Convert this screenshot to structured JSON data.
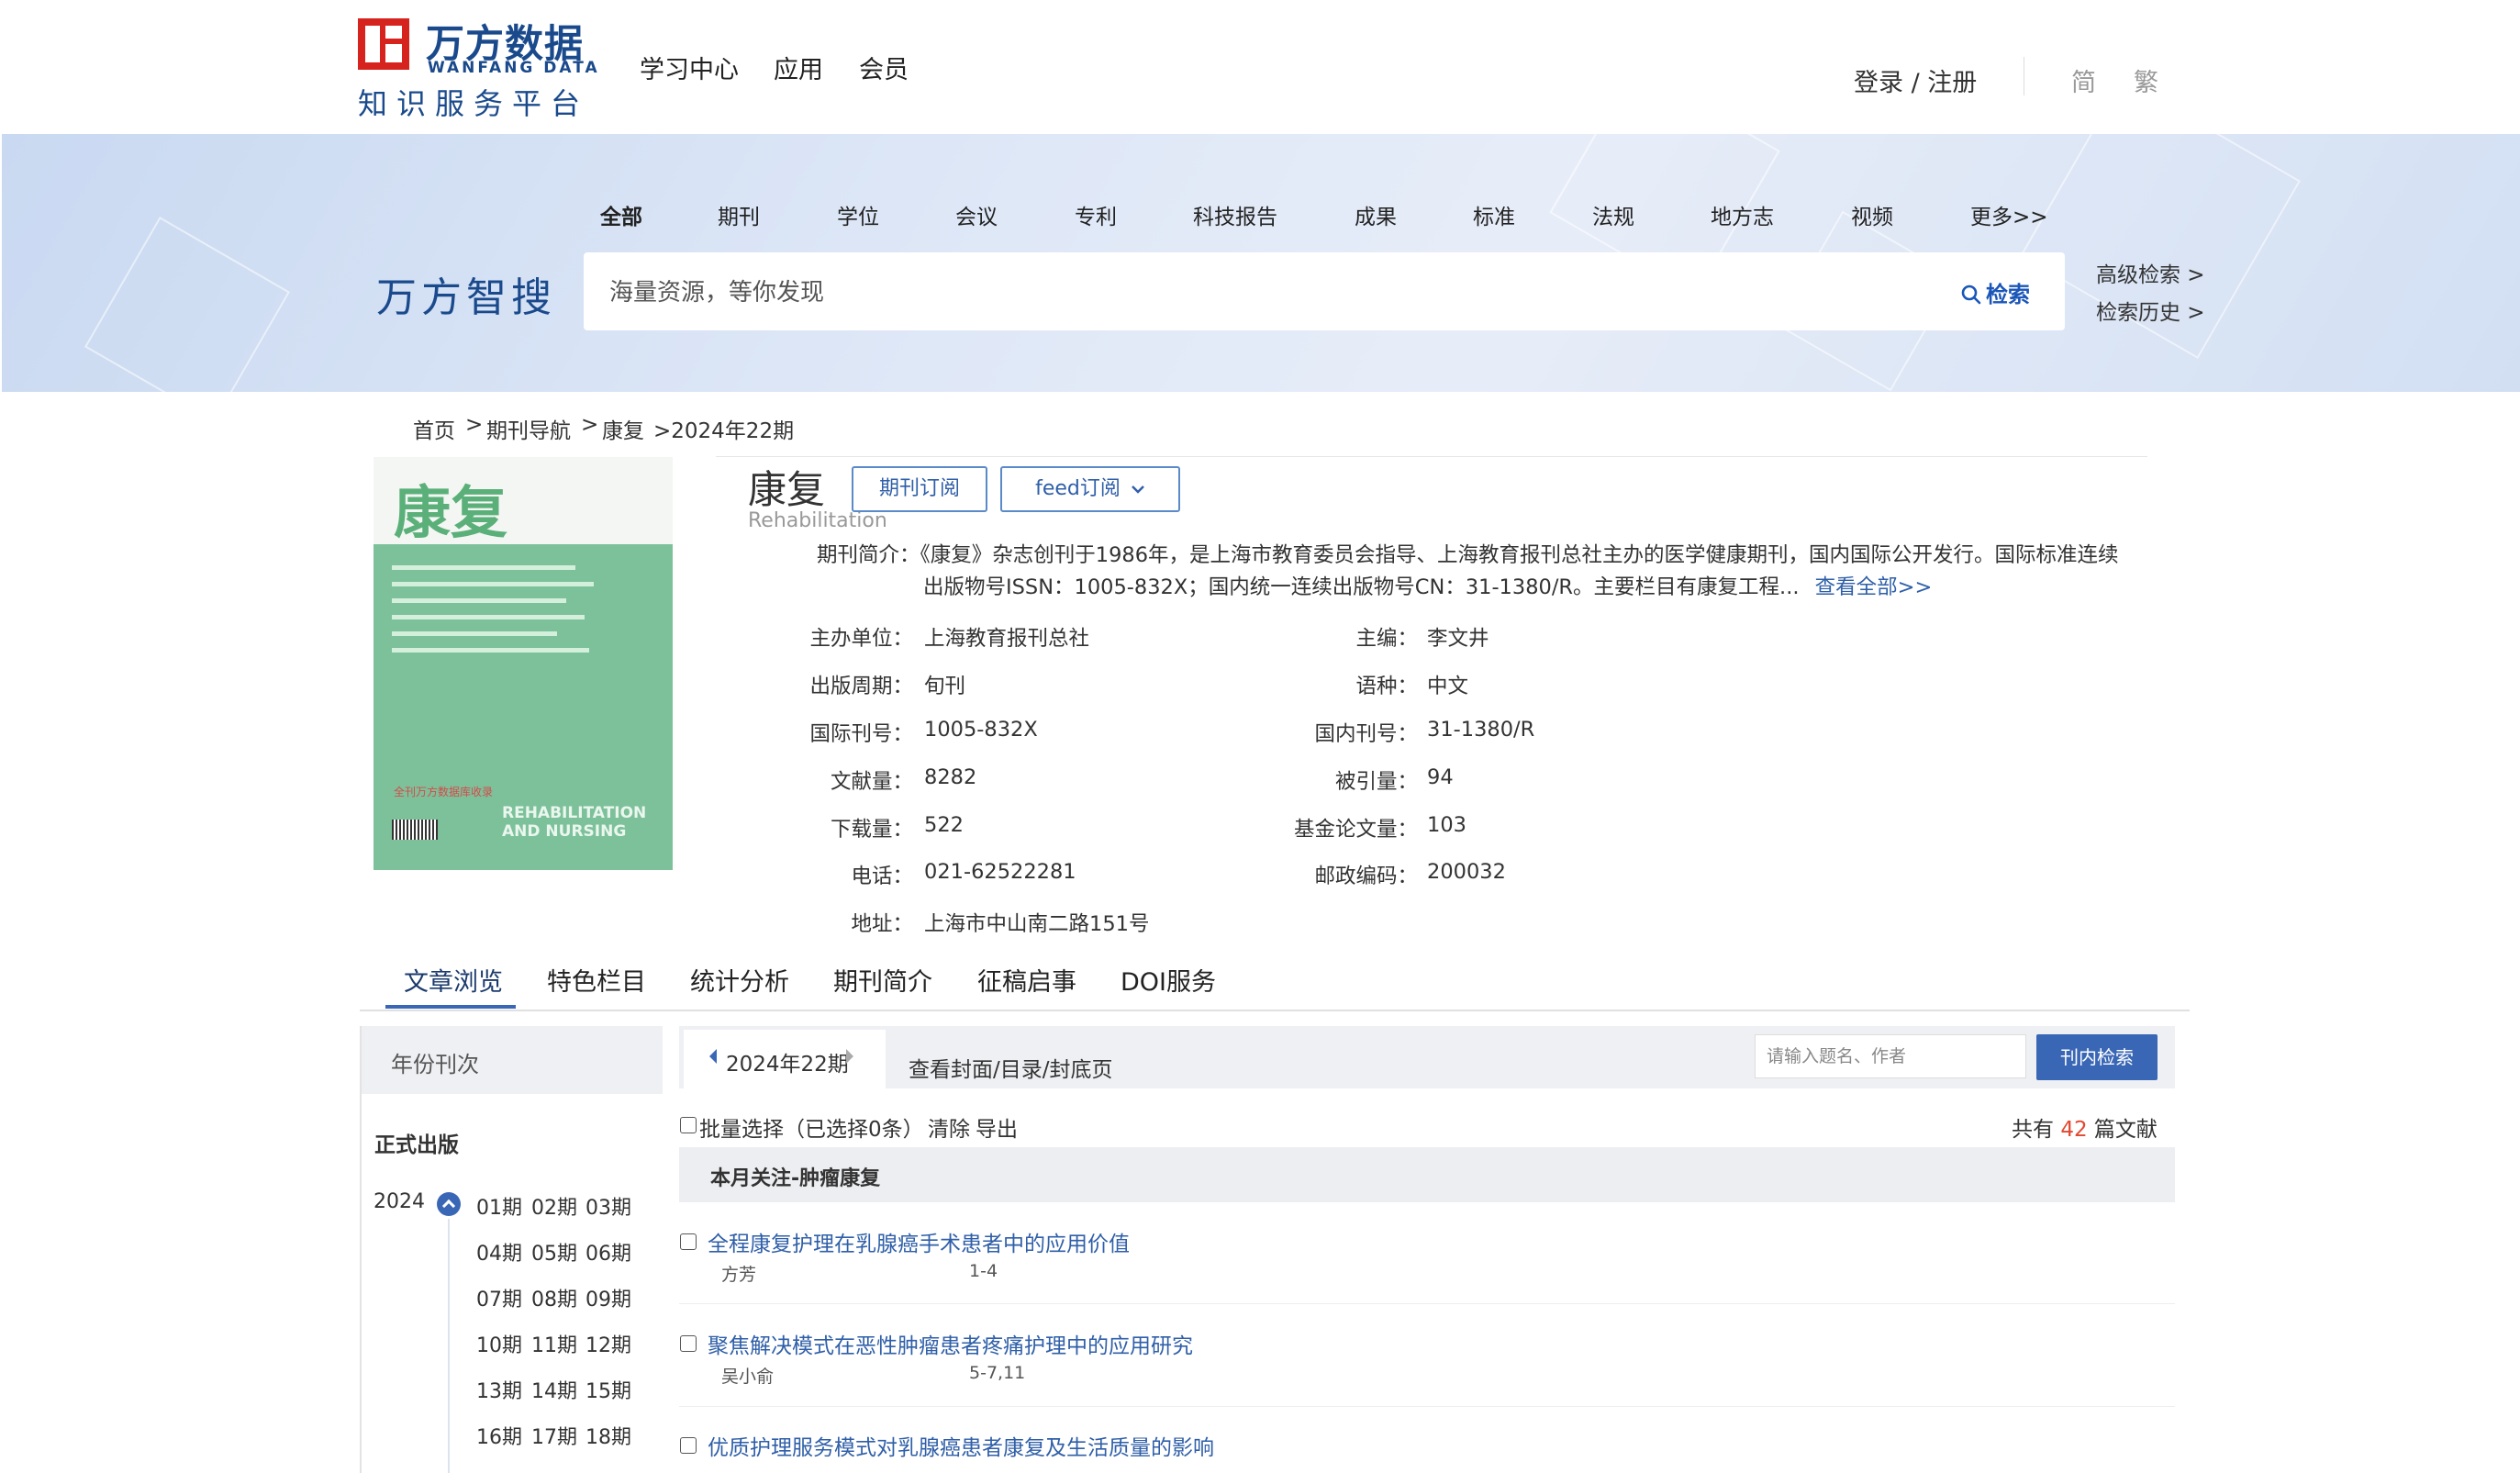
{
  "header": {
    "logo_cn": "万方数据",
    "logo_en": "WANFANG DATA",
    "logo_sub": "知识服务平台",
    "nav": [
      "学习中心",
      "应用",
      "会员"
    ],
    "login": "登录 / 注册",
    "lang_simplified": "简",
    "lang_traditional": "繁"
  },
  "search": {
    "tabs": [
      "全部",
      "期刊",
      "学位",
      "会议",
      "专利",
      "科技报告",
      "成果",
      "标准",
      "法规",
      "地方志",
      "视频",
      "更多>>"
    ],
    "brand": "万方智搜",
    "placeholder": "海量资源，等你发现",
    "button": "检索",
    "advanced": "高级检索 >",
    "history": "检索历史 >"
  },
  "breadcrumb": {
    "home": "首页",
    "sep1": ">",
    "nav": "期刊导航",
    "sep2": ">",
    "journal": "康复",
    "issue": ">2024年22期"
  },
  "journal": {
    "cover_title": "康复",
    "cover_en_1": "REHABILITATION",
    "cover_en_2": "AND NURSING",
    "cover_red": "全刊万方数据库收录",
    "title": "康复",
    "subtitle": "Rehabilitation",
    "subscribe_btn": "期刊订阅",
    "feed_btn": "feed订阅",
    "intro_label": "期刊简介：",
    "intro_text_1": "《康复》杂志创刊于1986年，是上海市教育委员会指导、上海教育报刊总社主办的医学健康期刊，国内国际公开发行。国际标准连续",
    "intro_text_2": "出版物号ISSN：1005-832X；国内统一连续出版物号CN：31-1380/R。主要栏目有康复工程...",
    "view_all": "查看全部>>",
    "fields_left": [
      {
        "label": "主办单位：",
        "value": "上海教育报刊总社"
      },
      {
        "label": "出版周期：",
        "value": "旬刊"
      },
      {
        "label": "国际刊号：",
        "value": "1005-832X"
      },
      {
        "label": "文献量：",
        "value": "8282"
      },
      {
        "label": "下载量：",
        "value": "522"
      },
      {
        "label": "电话：",
        "value": "021-62522281"
      },
      {
        "label": "地址：",
        "value": "上海市中山南二路151号"
      }
    ],
    "fields_right": [
      {
        "label": "主编：",
        "value": "李文井"
      },
      {
        "label": "语种：",
        "value": "中文"
      },
      {
        "label": "国内刊号：",
        "value": "31-1380/R"
      },
      {
        "label": "被引量：",
        "value": "94"
      },
      {
        "label": "基金论文量：",
        "value": "103"
      },
      {
        "label": "邮政编码：",
        "value": "200032"
      }
    ]
  },
  "content_tabs": [
    "文章浏览",
    "特色栏目",
    "统计分析",
    "期刊简介",
    "征稿启事",
    "DOI服务"
  ],
  "sidebar": {
    "header": "年份刊次",
    "section": "正式出版",
    "year": "2024",
    "issues": [
      "01期",
      "02期",
      "03期",
      "04期",
      "05期",
      "06期",
      "07期",
      "08期",
      "09期",
      "10期",
      "11期",
      "12期",
      "13期",
      "14期",
      "15期",
      "16期",
      "17期",
      "18期"
    ]
  },
  "panel": {
    "current_issue": "2024年22期",
    "view_cover": "查看封面/目录/封底页",
    "search_placeholder": "请输入题名、作者",
    "search_button": "刊内检索",
    "batch_select": "批量选择（已选择0条）",
    "clear": "清除",
    "export": "导出",
    "total_prefix": "共有",
    "total_count": "42",
    "total_suffix": "篇文献",
    "section_title": "本月关注-肿瘤康复",
    "articles": [
      {
        "title": "全程康复护理在乳腺癌手术患者中的应用价值",
        "author": "方芳",
        "pages": "1-4"
      },
      {
        "title": "聚焦解决模式在恶性肿瘤患者疼痛护理中的应用研究",
        "author": "吴小俞",
        "pages": "5-7,11"
      },
      {
        "title": "优质护理服务模式对乳腺癌患者康复及生活质量的影响",
        "author": "",
        "pages": ""
      }
    ]
  },
  "colors": {
    "brand_blue": "#1a4a8c",
    "link_blue": "#2f5fa8",
    "accent_blue": "#3a67b5",
    "logo_red": "#d6231e",
    "count_red": "#e2482f"
  }
}
